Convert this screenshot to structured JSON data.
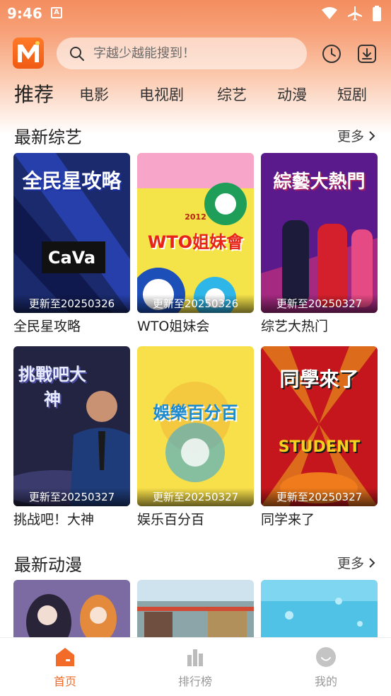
{
  "status_bar": {
    "time": "9:46",
    "notification_letter": "A"
  },
  "search": {
    "placeholder": "字越少越能搜到！"
  },
  "tabs": [
    {
      "label": "推荐",
      "active": true
    },
    {
      "label": "电影",
      "active": false
    },
    {
      "label": "电视剧",
      "active": false
    },
    {
      "label": "综艺",
      "active": false
    },
    {
      "label": "动漫",
      "active": false
    },
    {
      "label": "短剧",
      "active": false
    }
  ],
  "sections": {
    "variety": {
      "title": "最新综艺",
      "more": "更多",
      "items": [
        {
          "title": "全民星攻略",
          "update": "更新至20250326",
          "poster_text": "全民星攻略",
          "poster_sub": "CaVa"
        },
        {
          "title": "WTO姐妹会",
          "update": "更新至20250326",
          "poster_text": "WTO姐妹會",
          "poster_sub": "2012"
        },
        {
          "title": "综艺大热门",
          "update": "更新至20250327",
          "poster_text": "綜藝大熱門",
          "poster_sub": ""
        },
        {
          "title": "挑战吧！大神",
          "update": "更新至20250327",
          "poster_text": "挑戰吧大神",
          "poster_sub": ""
        },
        {
          "title": "娱乐百分百",
          "update": "更新至20250327",
          "poster_text": "娛樂百分百",
          "poster_sub": ""
        },
        {
          "title": "同学来了",
          "update": "更新至20250327",
          "poster_text": "同學來了",
          "poster_sub": "STUDENT"
        }
      ]
    },
    "anime": {
      "title": "最新动漫",
      "more": "更多"
    }
  },
  "bottom_nav": [
    {
      "label": "首页",
      "icon": "home-icon",
      "active": true
    },
    {
      "label": "排行榜",
      "icon": "ranking-icon",
      "active": false
    },
    {
      "label": "我的",
      "icon": "profile-icon",
      "active": false
    }
  ],
  "colors": {
    "accent": "#f26b28",
    "header_gradient_top": "#f38d5e"
  }
}
